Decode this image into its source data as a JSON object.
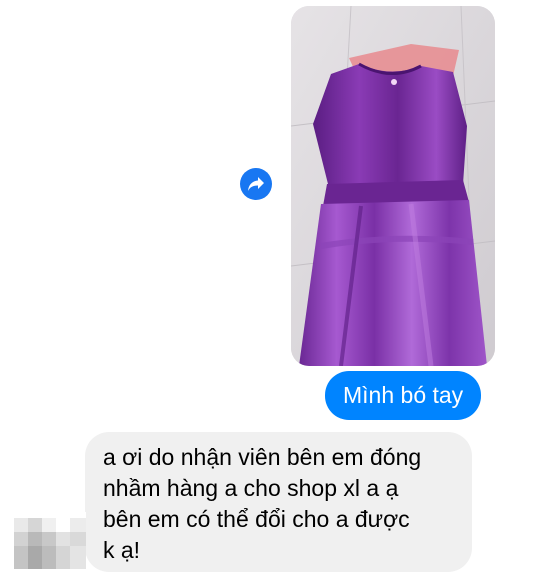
{
  "conversation": {
    "photo_message": {
      "image": "purple-satin-dress-photo",
      "dress_color": "#7b2fa0"
    },
    "forward_button": {
      "icon": "share-arrow-icon"
    },
    "sent_message": {
      "text": "Mình bó tay",
      "bubble_color": "#0084ff"
    },
    "received_message": {
      "lines": [
        "a ơi do nhận viên bên em đóng",
        "nhầm hàng a cho shop xl a ạ",
        "bên em có thể đổi cho a được",
        "k ạ!"
      ],
      "bubble_color": "#f0f0f0"
    },
    "sender_avatar": {
      "style": "pixelated"
    }
  }
}
